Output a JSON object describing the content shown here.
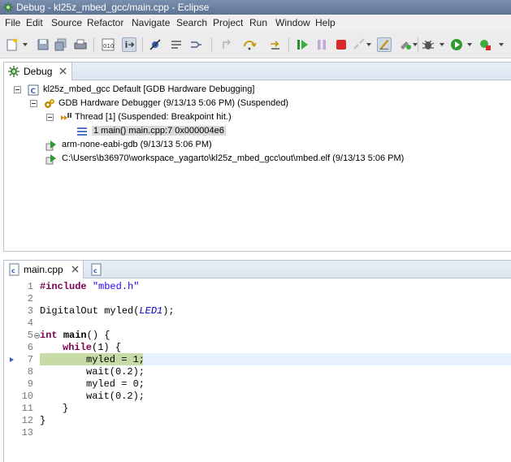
{
  "window": {
    "title": "Debug - kl25z_mbed_gcc/main.cpp - Eclipse"
  },
  "menu": [
    "File",
    "Edit",
    "Source",
    "Refactor",
    "Navigate",
    "Search",
    "Project",
    "Run",
    "Window",
    "Help"
  ],
  "debug_view": {
    "tab_label": "Debug",
    "tree": [
      {
        "label": "kl25z_mbed_gcc Default [GDB Hardware Debugging]",
        "icon": "launch-config-icon"
      },
      {
        "label": "GDB Hardware Debugger (9/13/13 5:06 PM) (Suspended)",
        "icon": "debugger-gear-icon"
      },
      {
        "label": "Thread [1] (Suspended: Breakpoint hit.)",
        "icon": "thread-suspended-icon"
      },
      {
        "label": "1 main() main.cpp:7 0x000004e6",
        "icon": "stack-frame-icon"
      },
      {
        "label": "arm-none-eabi-gdb (9/13/13 5:06 PM)",
        "icon": "process-icon"
      },
      {
        "label": "C:\\Users\\b36970\\workspace_yagarto\\kl25z_mbed_gcc\\out\\mbed.elf (9/13/13 5:06 PM)",
        "icon": "process-icon"
      }
    ]
  },
  "editor": {
    "tab_label": "main.cpp",
    "line_numbers": [
      "1",
      "2",
      "3",
      "4",
      "5",
      "6",
      "7",
      "8",
      "9",
      "10",
      "11",
      "12",
      "13"
    ],
    "current_line": "7",
    "code": {
      "l1_kw": "#include",
      "l1_str": "\"mbed.h\"",
      "l3_pre": "DigitalOut myled(",
      "l3_it": "LED1",
      "l3_post": ");",
      "l5_kw": "int",
      "l5_fn": "main",
      "l5_post": "() {",
      "l6_kw": "while",
      "l6_post": "(1) {",
      "l7": "myled = 1;",
      "l8": "wait(0.2);",
      "l9": "myled = 0;",
      "l10": "wait(0.2);",
      "l11": "}",
      "l12": "}"
    }
  },
  "colors": {
    "keyword": "#7f0055",
    "string": "#2a00ff",
    "current_line_bg": "#e8f2fe",
    "instruction_pointer": "#c6dba6"
  }
}
